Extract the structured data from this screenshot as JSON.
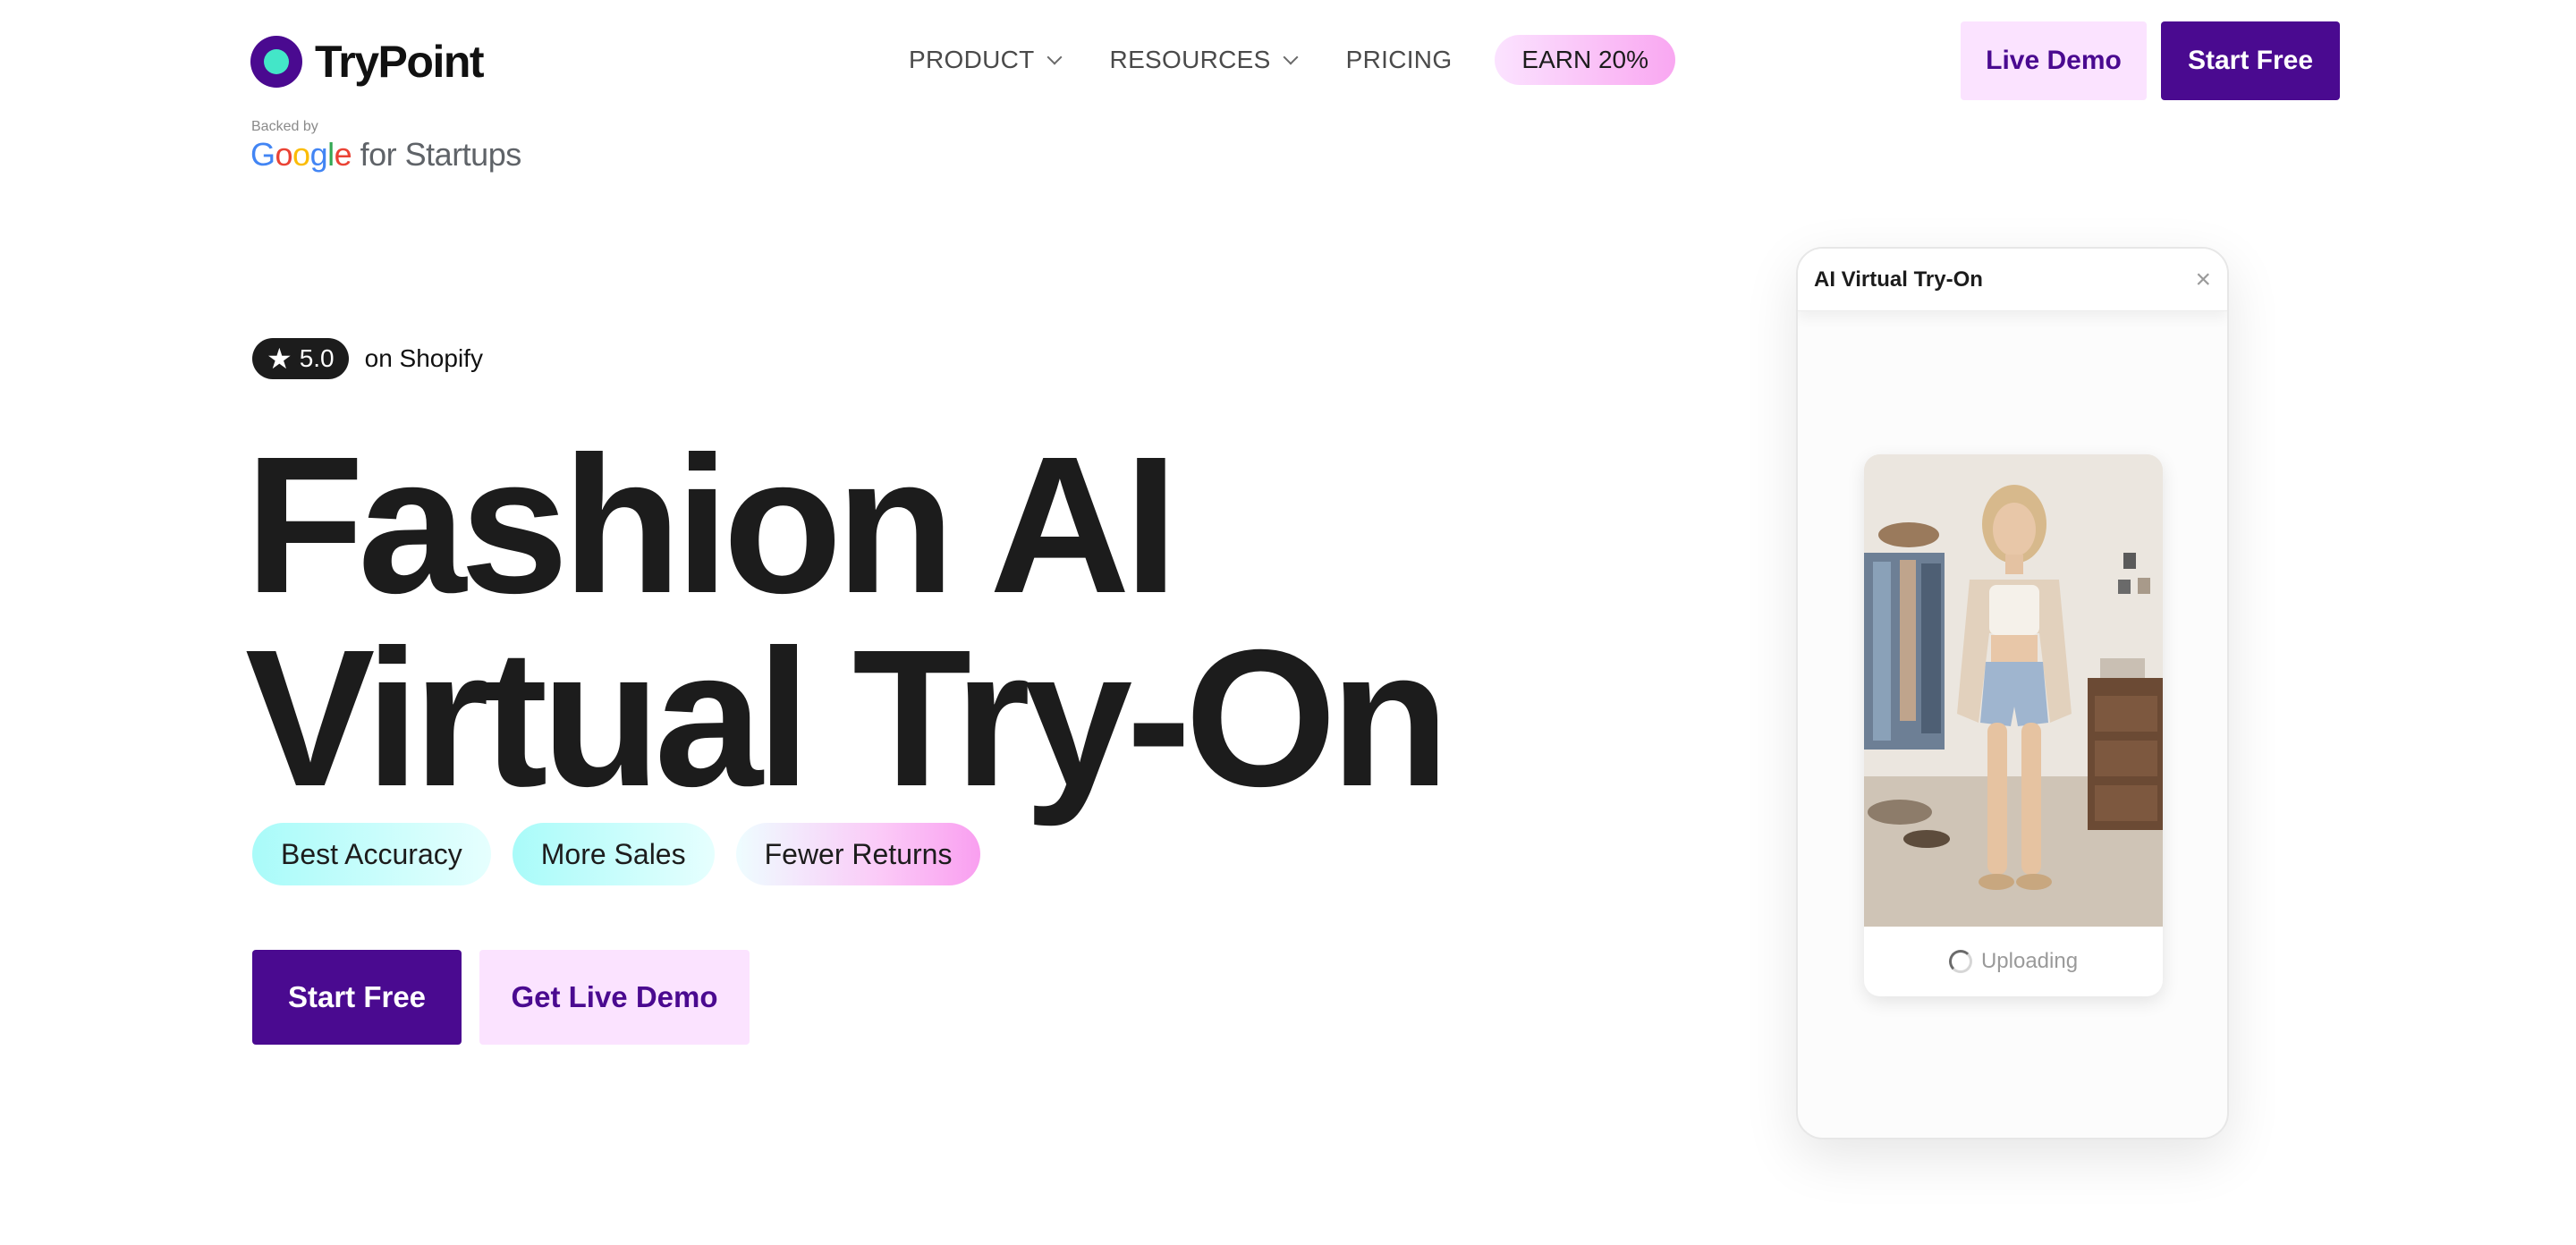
{
  "brand": {
    "name": "TryPoint",
    "backed_by": "Backed by",
    "partner": "Google for Startups"
  },
  "nav": {
    "items": [
      {
        "label": "PRODUCT",
        "has_dropdown": true
      },
      {
        "label": "RESOURCES",
        "has_dropdown": true
      },
      {
        "label": "PRICING",
        "has_dropdown": false
      }
    ],
    "earn_label": "EARN 20%"
  },
  "header_buttons": {
    "live_demo": "Live Demo",
    "start_free": "Start Free"
  },
  "hero": {
    "rating_value": "5.0",
    "rating_source": "on Shopify",
    "headline_line1": "Fashion AI",
    "headline_line2": "Virtual Try-On",
    "tags": [
      "Best Accuracy",
      "More Sales",
      "Fewer Returns"
    ],
    "cta_primary": "Start Free",
    "cta_secondary": "Get Live Demo"
  },
  "widget": {
    "title": "AI Virtual Try-On",
    "close_icon": "close-icon",
    "status": "Uploading"
  },
  "colors": {
    "brand_purple": "#4a0a90",
    "accent_teal": "#43e6c8",
    "pink_light": "#fbe3ff",
    "pink_strong": "#f99ff0",
    "cyan_light": "#a9fbf9",
    "text_dark": "#1c1c1c"
  }
}
